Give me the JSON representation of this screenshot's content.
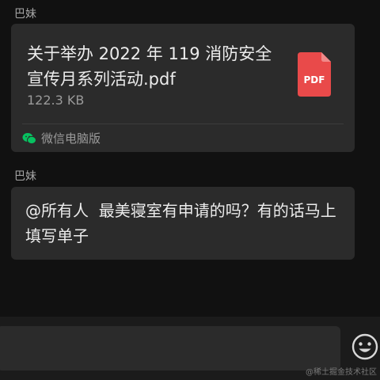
{
  "messages": [
    {
      "sender": "巴妹",
      "file": {
        "name": "关于举办 2022 年 119 消防安全宣传月系列活动.pdf",
        "size": "122.3 KB",
        "icon_label": "PDF",
        "source": "微信电脑版"
      }
    },
    {
      "sender": "巴妹",
      "text": "@所有人  最美寝室有申请的吗？有的话马上填写单子"
    }
  ],
  "watermark": "@稀土掘金技术社区",
  "colors": {
    "background": "#111111",
    "bubble": "#2b2b2b",
    "pdf_red": "#e94a4a",
    "wechat_green": "#07c160"
  },
  "icons": {
    "file_type": "pdf-file-icon",
    "source": "wechat-icon",
    "emoji": "emoji-icon"
  }
}
